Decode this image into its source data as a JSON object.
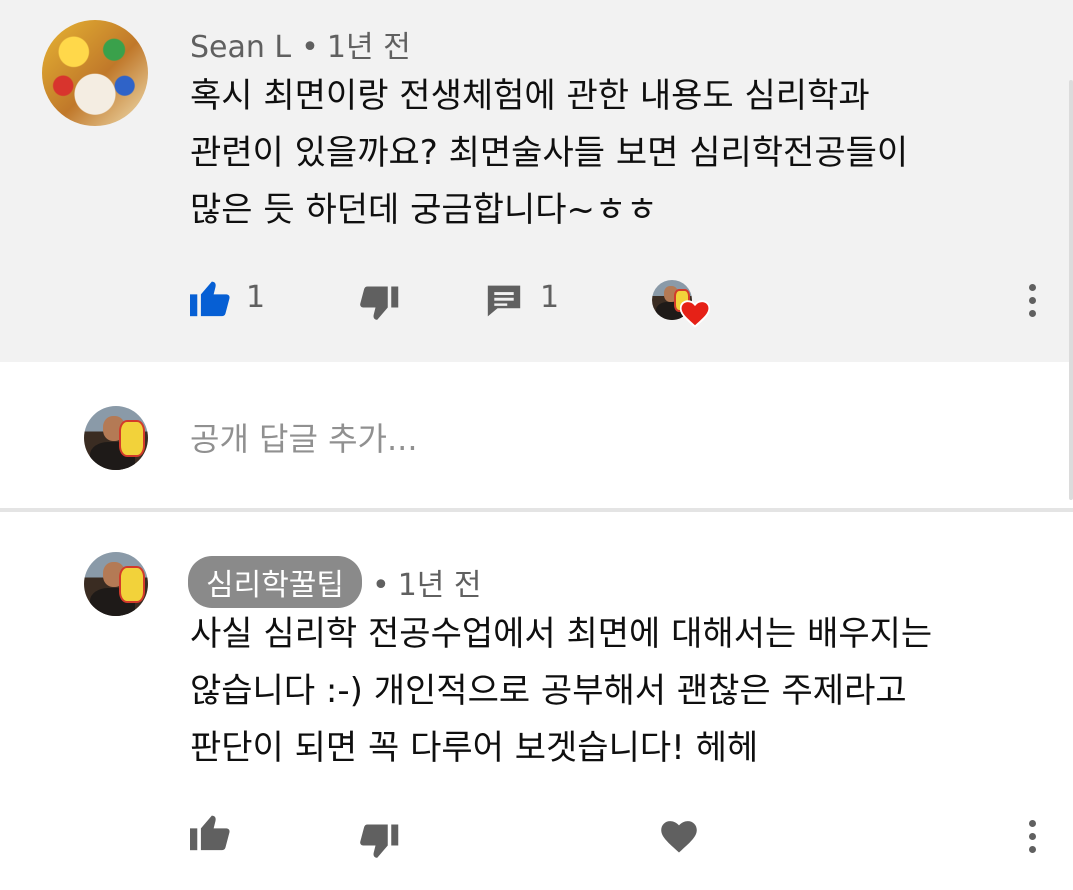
{
  "comment1": {
    "author": "Sean L",
    "separator": "•",
    "time": "1년 전",
    "lines": [
      "혹시 최면이랑 전생체험에 관한 내용도 심리학과",
      "관련이 있을까요? 최면술사들 보면 심리학전공들이",
      "많은 듯 하던데 궁금합니다~ㅎㅎ"
    ],
    "like_count": "1",
    "reply_count": "1",
    "like_icon": "thumbs-up-filled-icon",
    "dislike_icon": "thumbs-down-icon",
    "reply_icon": "comment-icon",
    "creator_heart_icon": "creator-heart-icon",
    "menu_icon": "more-vert-icon",
    "accent_color": "#065fd4",
    "heart_color": "#e62117"
  },
  "reply_input": {
    "placeholder": "공개 답글 추가..."
  },
  "comment2": {
    "author_badge": "심리학꿀팁",
    "separator": "•",
    "time": "1년 전",
    "lines": [
      "사실 심리학 전공수업에서 최면에 대해서는 배우지는",
      "않습니다 :-) 개인적으로 공부해서 괜찮은 주제라고",
      "판단이 되면 꼭 다루어 보겟습니다! 헤헤"
    ],
    "like_icon": "thumbs-up-icon",
    "dislike_icon": "thumbs-down-icon",
    "heart_icon": "heart-icon",
    "menu_icon": "more-vert-icon"
  }
}
